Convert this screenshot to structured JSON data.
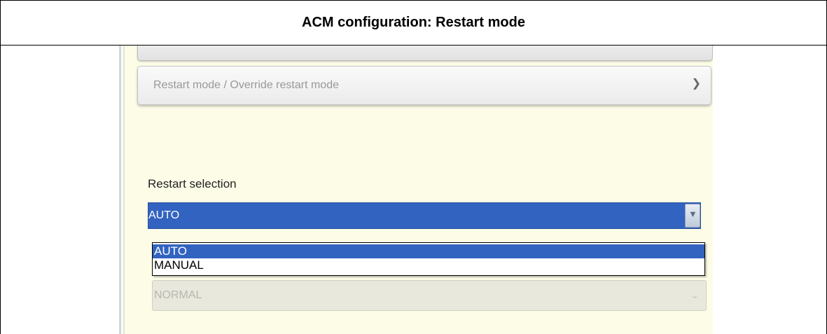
{
  "title": "ACM configuration: Restart mode",
  "accordion": {
    "label": "Restart mode / Override restart mode"
  },
  "restart": {
    "label": "Restart selection",
    "value": "AUTO",
    "options": [
      "AUTO",
      "MANUAL"
    ]
  },
  "next_field": {
    "value": "NORMAL"
  },
  "colors": {
    "selection_blue": "#3263c0",
    "panel_background": "#fdfde7"
  },
  "icons": {
    "accordion_chevron": "chevron-down-icon",
    "select_arrow": "chevron-down-icon"
  }
}
